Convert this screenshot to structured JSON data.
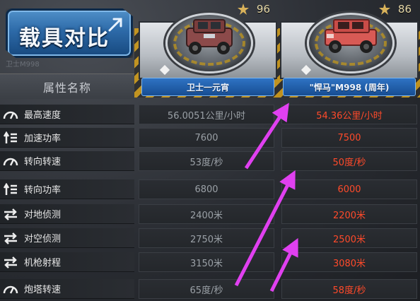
{
  "title": "载具对比",
  "ghost_label": "卫士M998",
  "attribute_header": "属性名称",
  "vehicles": [
    {
      "name": "卫士一元宵",
      "score": "96",
      "color": "#8c4a4a"
    },
    {
      "name": "\"悍马\"M998 (周年)",
      "score": "86",
      "color": "#d85a55"
    }
  ],
  "stats": [
    {
      "icon": "speedometer-icon",
      "label": "最高速度",
      "v1": "56.0051公里/小时",
      "v2": "54.36公里/小时"
    },
    {
      "icon": "accel-icon",
      "label": "加速功率",
      "v1": "7600",
      "v2": "7500"
    },
    {
      "icon": "speedometer-icon",
      "label": "转向转速",
      "v1": "53度/秒",
      "v2": "50度/秒"
    },
    {
      "icon": "accel-icon",
      "label": "转向功率",
      "v1": "6800",
      "v2": "6000"
    },
    {
      "icon": "swap-icon",
      "label": "对地侦测",
      "v1": "2400米",
      "v2": "2200米"
    },
    {
      "icon": "swap-icon",
      "label": "对空侦测",
      "v1": "2750米",
      "v2": "2500米"
    },
    {
      "icon": "swap-icon",
      "label": "机枪射程",
      "v1": "3150米",
      "v2": "3080米"
    },
    {
      "icon": "speedometer-icon",
      "label": "炮塔转速",
      "v1": "65度/秒",
      "v2": "58度/秒"
    }
  ],
  "colors": {
    "accent_blue": "#2d6aa8",
    "worse_value": "#ff4a2a",
    "normal_value": "#9aa0a6",
    "annotation_arrow": "#e040f0",
    "hazard_yellow": "#d9a21a"
  }
}
